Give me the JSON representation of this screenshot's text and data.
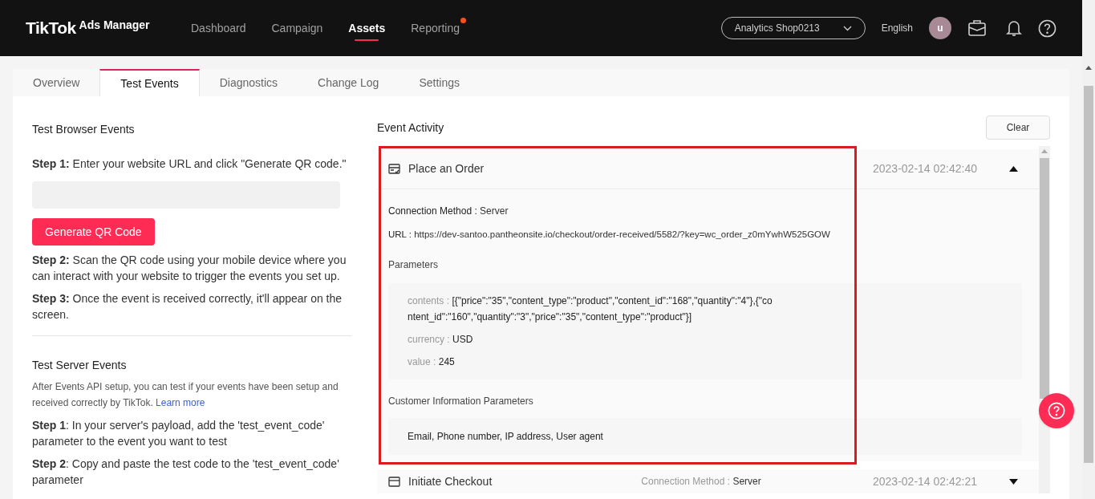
{
  "navbar": {
    "logo": {
      "brand": "TikTok",
      "product": "Ads Manager"
    },
    "items": [
      {
        "label": "Dashboard",
        "selected": false,
        "badge": false
      },
      {
        "label": "Campaign",
        "selected": false,
        "badge": false
      },
      {
        "label": "Assets",
        "selected": true,
        "badge": false
      },
      {
        "label": "Reporting",
        "selected": false,
        "badge": true
      }
    ],
    "account": "Analytics Shop0213",
    "language": "English",
    "avatar": "u"
  },
  "tabs": [
    {
      "label": "Overview",
      "selected": false
    },
    {
      "label": "Test Events",
      "selected": true
    },
    {
      "label": "Diagnostics",
      "selected": false
    },
    {
      "label": "Change Log",
      "selected": false
    },
    {
      "label": "Settings",
      "selected": false
    }
  ],
  "browser_events": {
    "title": "Test Browser Events",
    "steps": [
      "**Step 1:** Enter your website URL and click \"Generate QR code.\"",
      "**Step 2:** Scan the QR code using your mobile device where you can interact with your website to trigger the events you set up.",
      "**Step 3:** Once the event is received correctly, it'll appear on the screen."
    ],
    "button": "Generate QR Code"
  },
  "server_events": {
    "title": "Test Server Events",
    "description": "After Events API setup, you can test if your events have been setup and received correctly by TikTok.",
    "link": "Learn more",
    "steps": [
      "**Step 1**: In your server's payload, add the 'test_event_code' parameter to the event you want to test",
      "**Step 2**: Copy and paste the test code to the 'test_event_code' parameter"
    ]
  },
  "event_activity": {
    "title": "Event Activity",
    "clear_button": "Clear",
    "events": [
      {
        "name": "Place an Order",
        "expanded": true,
        "timestamp": "2023-02-14 02:42:40",
        "connection": {
          "label": "Connection Method :",
          "value": "Server"
        },
        "url": {
          "label": "URL :",
          "value": "https://dev-santoo.pantheonsite.io/checkout/order-received/5582/?key=wc_order_z0mYwhW525GOW"
        },
        "parameters_title": "Parameters",
        "parameters": [
          {
            "key": "contents :",
            "value": "[{\"price\":\"35\",\"content_type\":\"product\",\"content_id\":\"168\",\"quantity\":\"4\"},{\"content_id\":\"160\",\"quantity\":\"3\",\"price\":\"35\",\"content_type\":\"product\"}]"
          },
          {
            "key": "currency :",
            "value": "USD"
          },
          {
            "key": "value :",
            "value": "245"
          }
        ],
        "customer_title": "Customer Information Parameters",
        "customer_value": "Email, Phone number, IP address, User agent"
      },
      {
        "name": "Initiate Checkout",
        "expanded": false,
        "timestamp": "2023-02-14 02:42:21",
        "connection": {
          "label": "Connection Method :",
          "value": "Server"
        }
      }
    ]
  }
}
